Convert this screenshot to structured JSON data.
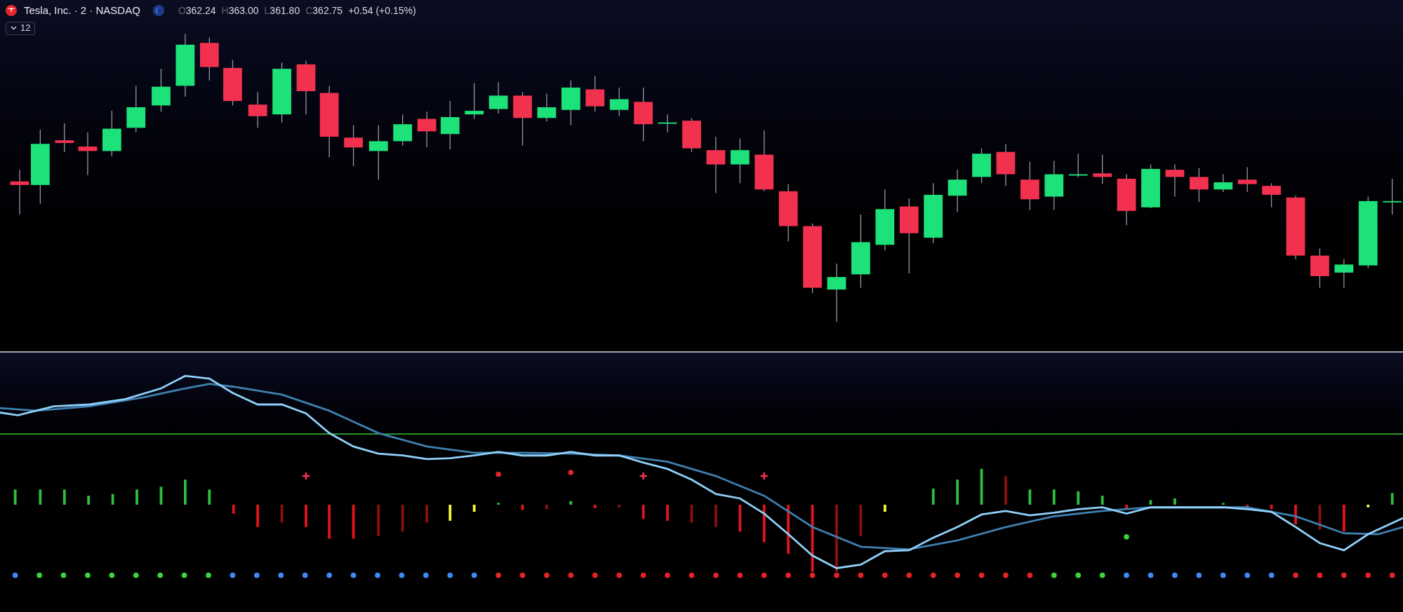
{
  "header": {
    "symbol_title": "Tesla, Inc. · 2 · NASDAQ",
    "ohlc": [
      {
        "label": "O",
        "value": "362.24"
      },
      {
        "label": "H",
        "value": "363.00"
      },
      {
        "label": "L",
        "value": "361.80"
      },
      {
        "label": "C",
        "value": "362.75"
      }
    ],
    "change": "+0.54 (+0.15%)",
    "interval_button": "12"
  }
}
